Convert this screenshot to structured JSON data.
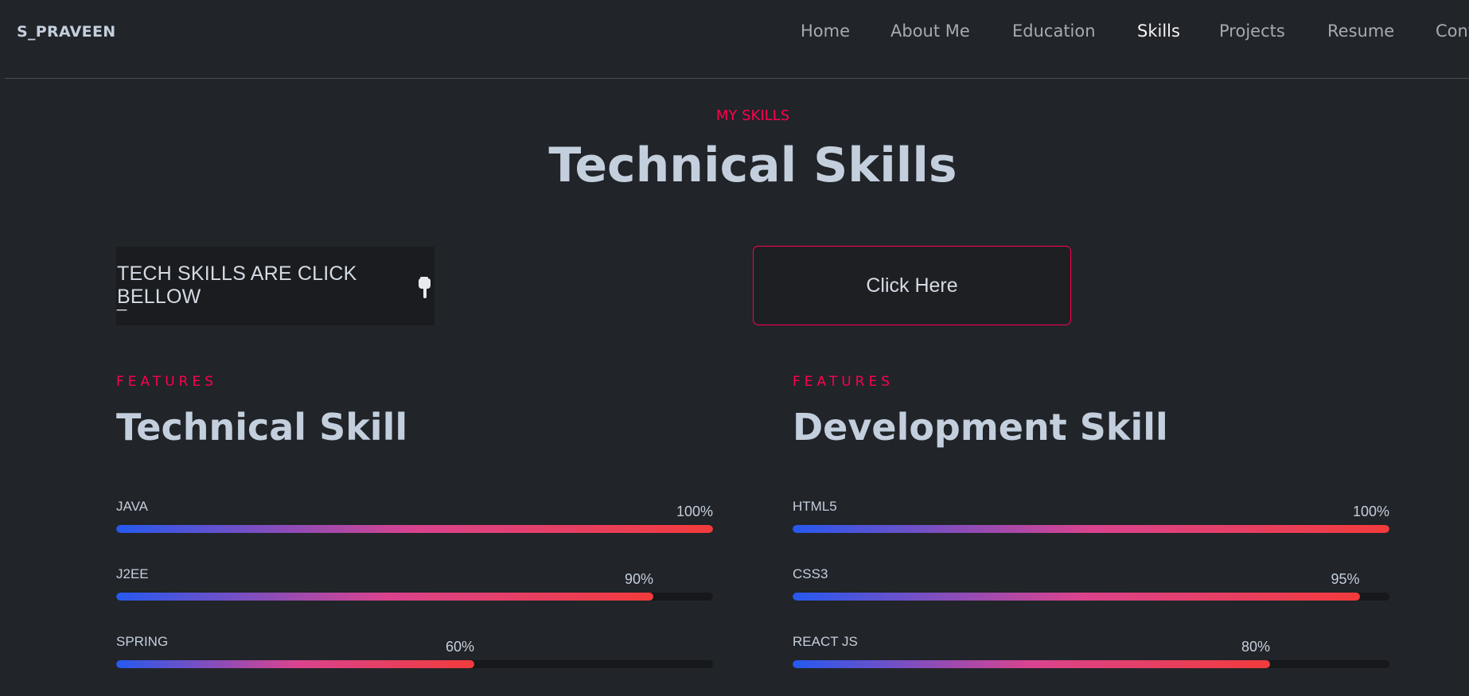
{
  "nav": {
    "brand": "S_PRAVEEN",
    "items": [
      {
        "label": "Home",
        "active": false
      },
      {
        "label": "About Me",
        "active": false
      },
      {
        "label": "Education",
        "active": false
      },
      {
        "label": "Skills",
        "active": true
      },
      {
        "label": "Projects",
        "active": false
      },
      {
        "label": "Resume",
        "active": false
      },
      {
        "label": "Contact",
        "active": false
      }
    ]
  },
  "header": {
    "subtitle": "MY SKILLS",
    "title": "Technical Skills"
  },
  "tech_box": {
    "text": "TECH SKILLS ARE CLICK BELLOW",
    "cursor": "_",
    "icon": "pointing-hand-icon"
  },
  "cta": {
    "label": "Click Here"
  },
  "sections": [
    {
      "eyebrow": "FEATURES",
      "title": "Technical Skill",
      "skills": [
        {
          "name": "JAVA",
          "percent": 100,
          "label": "100%"
        },
        {
          "name": "J2EE",
          "percent": 90,
          "label": "90%"
        },
        {
          "name": "SPRING",
          "percent": 60,
          "label": "60%"
        }
      ]
    },
    {
      "eyebrow": "FEATURES",
      "title": "Development Skill",
      "skills": [
        {
          "name": "HTML5",
          "percent": 100,
          "label": "100%"
        },
        {
          "name": "CSS3",
          "percent": 95,
          "label": "95%"
        },
        {
          "name": "REACT JS",
          "percent": 80,
          "label": "80%"
        }
      ]
    }
  ],
  "colors": {
    "background": "#212428",
    "accent": "#ff014f",
    "text": "#c4cfde",
    "bar_start": "#2659ef",
    "bar_end": "#f23b3b"
  }
}
